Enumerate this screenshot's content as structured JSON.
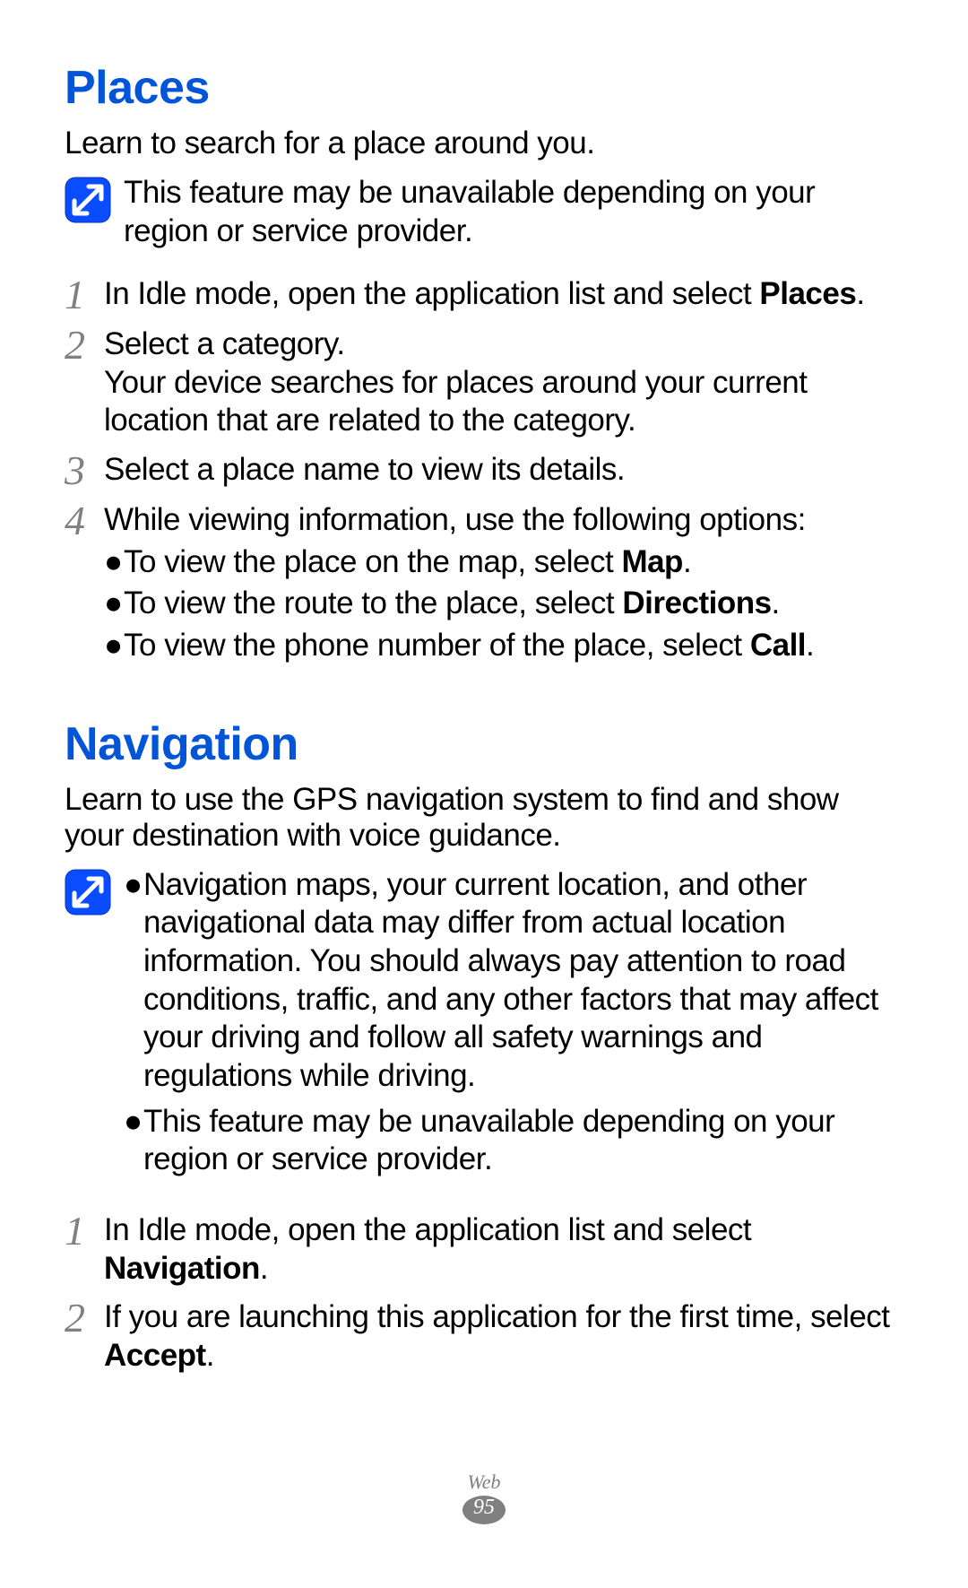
{
  "sections": {
    "places": {
      "heading": "Places",
      "intro": "Learn to search for a place around you.",
      "note": "This feature may be unavailable depending on your region or service provider.",
      "steps": {
        "s1_a": "In Idle mode, open the application list and select ",
        "s1_b": "Places",
        "s1_c": ".",
        "s2_a": "Select a category.",
        "s2_b": "Your device searches for places around your current location that are related to the category.",
        "s3": "Select a place name to view its details.",
        "s4": "While viewing information, use the following options:",
        "s4_bullets": {
          "b1_a": "To view the place on the map, select ",
          "b1_b": "Map",
          "b1_c": ".",
          "b2_a": "To view the route to the place, select ",
          "b2_b": "Directions",
          "b2_c": ".",
          "b3_a": "To view the phone number of the place, select ",
          "b3_b": "Call",
          "b3_c": "."
        }
      }
    },
    "navigation": {
      "heading": "Navigation",
      "intro": "Learn to use the GPS navigation system to find and show your destination with voice guidance.",
      "note_bullets": {
        "b1": "Navigation maps, your current location, and other navigational data may differ from actual location information. You should always pay attention to road conditions, traffic, and any other factors that may affect your driving and follow all safety warnings and regulations while driving.",
        "b2": "This feature may be unavailable depending on your region or service provider."
      },
      "steps": {
        "s1_a": "In Idle mode, open the application list and select ",
        "s1_b": "Navigation",
        "s1_c": ".",
        "s2_a": "If you are launching this application for the first time, select ",
        "s2_b": "Accept",
        "s2_c": "."
      }
    }
  },
  "footer": {
    "label": "Web",
    "page": "95"
  },
  "nums": {
    "n1": "1",
    "n2": "2",
    "n3": "3",
    "n4": "4"
  },
  "bullet": "●"
}
